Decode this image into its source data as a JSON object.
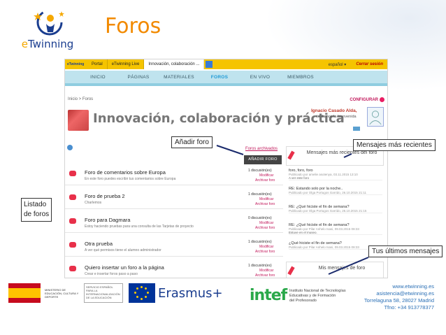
{
  "slide": {
    "title": "Foros",
    "logo_e": "e",
    "logo_rest": "Twinning"
  },
  "topbar": {
    "logo": "eTwinning",
    "items": [
      "Portal",
      "eTwinning Live",
      "Innovación, colaboración ..."
    ],
    "language": "español ▾",
    "logout": "Cerrar sesión"
  },
  "navbar": {
    "items": [
      "INICIO",
      "PÁGINAS",
      "MATERIALES",
      "FOROS",
      "EN VIVO",
      "MIEMBROS"
    ],
    "active": "FOROS"
  },
  "breadcrumb": "Inicio  >  Foros",
  "config": "CONFIGURAR",
  "group": {
    "title": "Innovación, colaboración y práctica",
    "user_name": "Ignacio Casado Alda,",
    "user_welcome": "te damos la bienvenida"
  },
  "forums_archived": "Foros archivados",
  "add_forum_button": "AÑADIR FORO",
  "forums": [
    {
      "title": "Foro de comentarios sobre Europa",
      "desc": "En este foro puedes escribir tus comentarios sobre Europa",
      "count": "1 discusión(es)",
      "modify": "Modificar",
      "archive": "Archivar foro"
    },
    {
      "title": "Foro de prueba 2",
      "desc": "Charlemos",
      "count": "1 discusión(es)",
      "modify": "Modificar",
      "archive": "Archivar foro"
    },
    {
      "title": "Foro para Dagmara",
      "desc": "Estoy haciendo pruebas para una consulta de las Tarjetas de proyecto",
      "count": "0 discusión(es)",
      "modify": "Modificar",
      "archive": "Archivar foro"
    },
    {
      "title": "Otra prueba",
      "desc": "A ver qué permisos tiene el alumno administrador",
      "count": "1 discusión(es)",
      "modify": "Modificar",
      "archive": "Archivar foro"
    },
    {
      "title": "Quiero insertar un foro a la página",
      "desc": "Crear e insertar foros paso a paso",
      "count": "1 discusión(es)",
      "modify": "Modificar",
      "archive": "Archivar foro"
    }
  ],
  "recent": {
    "title": "Mensajes más recientes del foro",
    "messages": [
      {
        "title": "foro, foro, foro",
        "meta": "Publicado por amelie asotenya, 03.11.2015 13:10",
        "excerpt": "A ver este foro"
      },
      {
        "title": "RE: Estando solo por la noche..",
        "meta": "Publicado por Olga Portugos Garrido, 26.10.2015 21:11",
        "excerpt": ""
      },
      {
        "title": "RE: ¿Qué hiciste el fin de semana?",
        "meta": "Publicado por Olga Portugos Garrido, 26.10.2015 21:15",
        "excerpt": ""
      },
      {
        "title": "RE: ¿Qué hiciste el fin de semana?",
        "meta": "Publicado por Pilar Anhelo Isasi, 09.03.2015 08:33",
        "excerpt": "Estuve en el museo."
      },
      {
        "title": "¿Qué hiciste el fin de semana?",
        "meta": "Publicado por Pilar Anhelo Isasi, 09.03.2015 08:33",
        "excerpt": ""
      }
    ]
  },
  "my_messages": {
    "title": "Mis mensajes de foro"
  },
  "callouts": {
    "add_forum": "Añadir foro",
    "recent": "Mensajes más recientes",
    "my_messages": "Tus últimos mensajes",
    "list_line1": "Listado",
    "list_line2": "de foros"
  },
  "footer": {
    "ministry": "MINISTERIO DE EDUCACIÓN, CULTURA Y DEPORTE",
    "sepie": "SERVICIO ESPAÑOL PARA LA INTERNACIONALIZACIÓN DE LA EDUCACIÓN",
    "erasmus": "Erasmus+",
    "intef": "intef",
    "intef_text_1": "Instituto Nacional de Tecnologías",
    "intef_text_2": "Educativas y de Formación",
    "intef_text_3": "del Profesorado",
    "contact_web": "www.etwinning.es",
    "contact_email": "asistencia@etwinning.es",
    "contact_address": "Torrelaguna 58, 28027 Madrid",
    "contact_phone": "Tfno: +34 913778377"
  },
  "colors": {
    "accent": "#f28a00",
    "topbar": "#f5c400",
    "nav": "#bfe3ee",
    "link": "#c2185b"
  }
}
